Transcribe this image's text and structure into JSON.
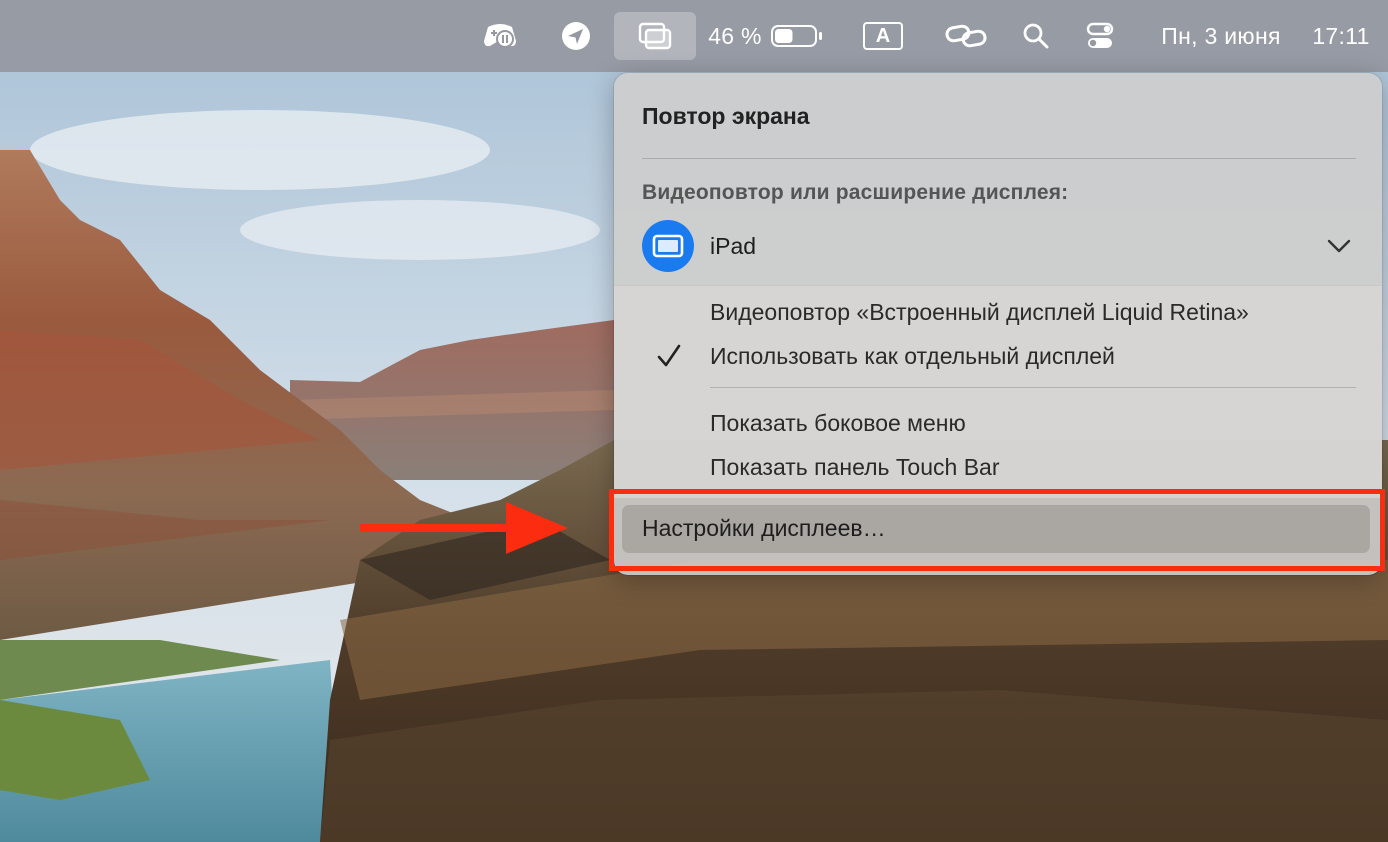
{
  "menubar": {
    "battery_percent": "46 %",
    "battery_level": 0.46,
    "keyboard_layout": "A",
    "date": "Пн, 3 июня",
    "time": "17:11",
    "icons": [
      "gamepad-status-icon",
      "location-arrow-icon",
      "screen-mirroring-icon",
      "battery-icon",
      "input-source-icon",
      "link-icon",
      "search-icon",
      "control-center-icon"
    ]
  },
  "panel": {
    "title": "Повтор экрана",
    "section_label": "Видеоповтор или расширение дисплея:",
    "device": {
      "name": "iPad",
      "icon": "ipad-icon",
      "chevron": "chevron-down-icon"
    },
    "options": [
      {
        "label": "Видеоповтор «Встроенный дисплей Liquid Retina»",
        "checked": false
      },
      {
        "label": "Использовать как отдельный дисплей",
        "checked": true
      }
    ],
    "extra_items": [
      {
        "label": "Показать боковое меню"
      },
      {
        "label": "Показать панель Touch Bar"
      }
    ],
    "settings_item": "Настройки дисплеев…"
  },
  "colors": {
    "accent_blue": "#1a7bf0",
    "annotation_red": "#fb2c10",
    "menubar": "#9698a0"
  }
}
